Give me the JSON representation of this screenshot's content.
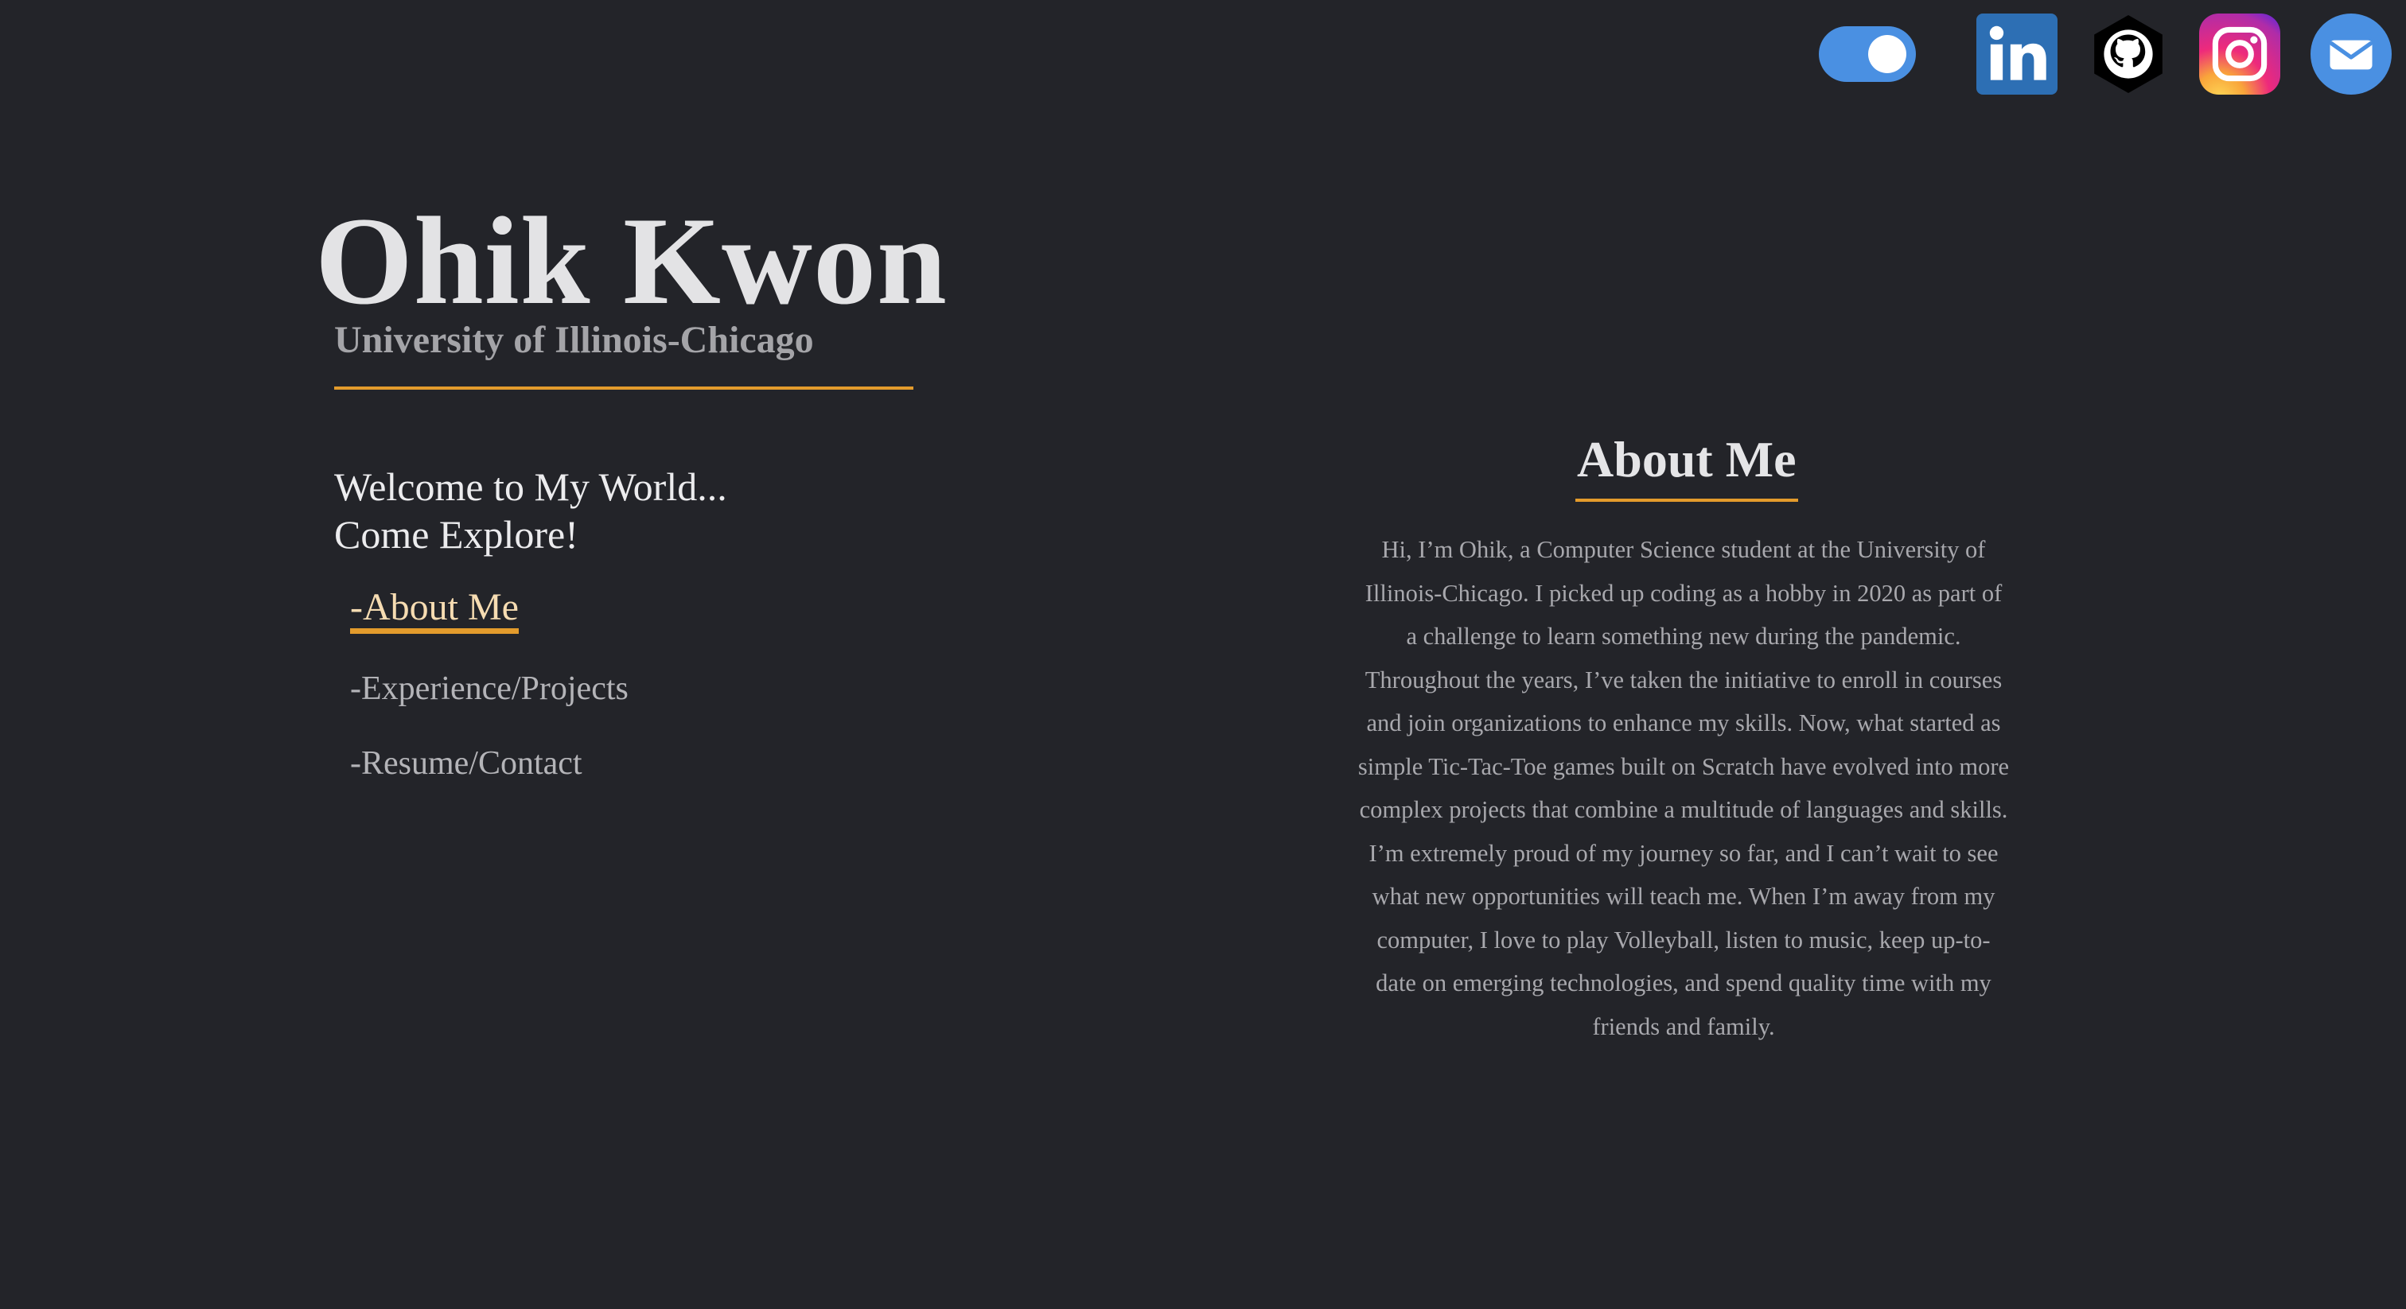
{
  "colors": {
    "background": "#232429",
    "accent": "#e39b2c",
    "toggle": "#4a90e2",
    "linkedin": "#2d6fb4",
    "github_bg": "#000000",
    "instagram_gradient": [
      "#f9ce34",
      "#ee2a7b",
      "#6228d7"
    ],
    "mail": "#4a90e2"
  },
  "header": {
    "theme_toggle": {
      "state": "on"
    },
    "social_links": [
      {
        "name": "LinkedIn",
        "icon": "linkedin-icon"
      },
      {
        "name": "GitHub",
        "icon": "github-icon"
      },
      {
        "name": "Instagram",
        "icon": "instagram-icon"
      },
      {
        "name": "Email",
        "icon": "mail-icon"
      }
    ]
  },
  "hero": {
    "name": "Ohik Kwon",
    "school": "University of Illinois-Chicago"
  },
  "welcome": {
    "line1": "Welcome to My World...",
    "line2": "Come Explore!"
  },
  "nav": {
    "items": [
      {
        "label": "-About Me",
        "active": true
      },
      {
        "label": "-Experience/Projects",
        "active": false
      },
      {
        "label": "-Resume/Contact",
        "active": false
      }
    ]
  },
  "about": {
    "title": "About Me",
    "body": "Hi, I’m Ohik, a Computer Science student at the University of Illinois-Chicago. I picked up coding as a hobby in 2020 as part of a challenge to learn something new during the pandemic. Throughout the years, I’ve taken the initiative to enroll in courses and join organizations to enhance my skills. Now, what started as simple Tic-Tac-Toe games built on Scratch have evolved into more complex projects that combine a multitude of languages and skills. I’m extremely proud of my journey so far, and I can’t wait to see what new opportunities will teach me. When I’m away from my computer, I love to play Volleyball, listen to music, keep up-to-date on emerging technologies, and spend quality time with my friends and family."
  }
}
